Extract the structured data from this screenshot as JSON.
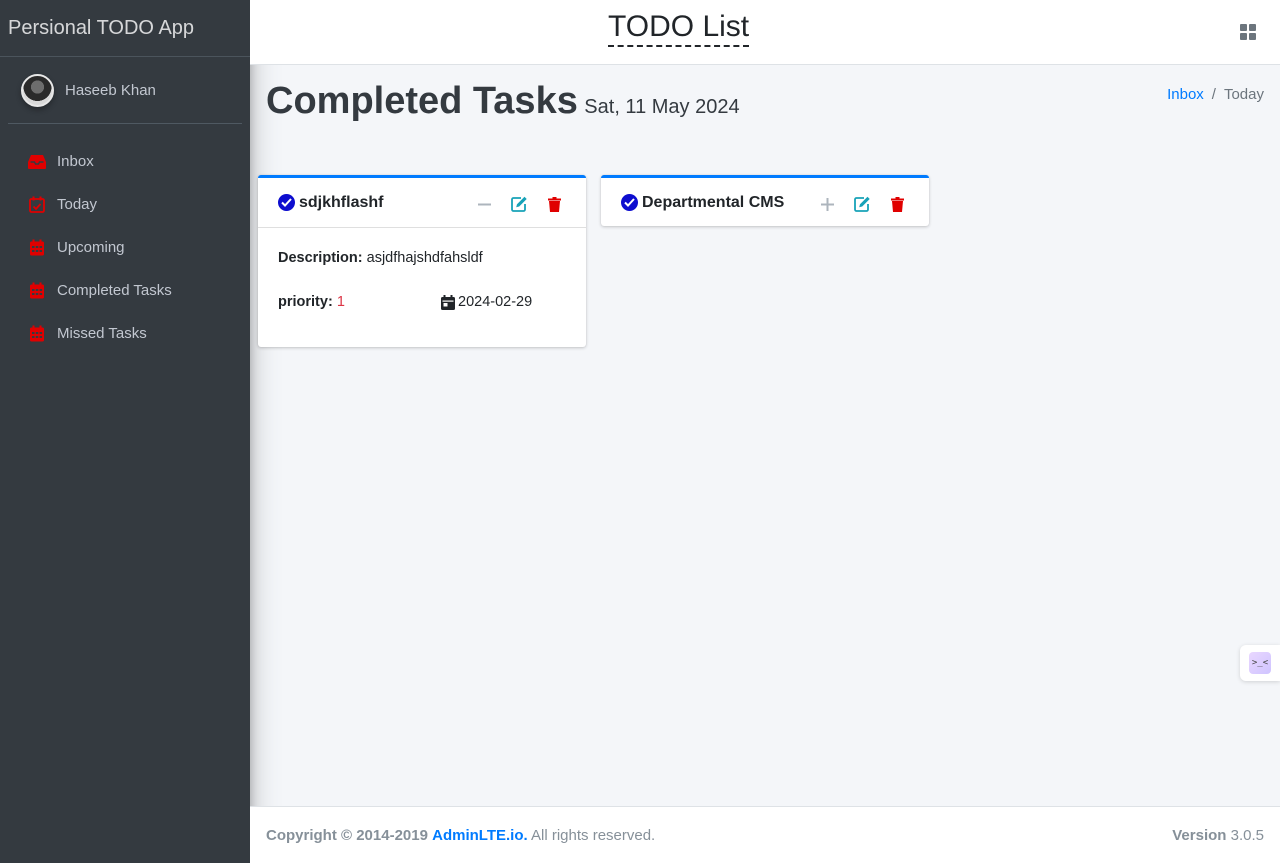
{
  "sidebar": {
    "brand": "Persional TODO App",
    "user": {
      "name": "Haseeb Khan"
    },
    "items": [
      {
        "label": "Inbox",
        "icon": "inbox-icon"
      },
      {
        "label": "Today",
        "icon": "calendar-check-icon"
      },
      {
        "label": "Upcoming",
        "icon": "calendar-icon"
      },
      {
        "label": "Completed Tasks",
        "icon": "calendar-icon"
      },
      {
        "label": "Missed Tasks",
        "icon": "calendar-icon"
      }
    ],
    "icon_color": "#e00000"
  },
  "navbar": {
    "title": "TODO List",
    "apps_icon": "grid-icon"
  },
  "content_header": {
    "title": "Completed Tasks",
    "date": "Sat, 11 May 2024",
    "breadcrumb": {
      "link": "Inbox",
      "separator": "/",
      "active": "Today"
    }
  },
  "tasks": [
    {
      "title": "sdjkhflashf",
      "description_label": "Description:",
      "description": "asjdfhajshdfahsldf",
      "priority_label": "priority:",
      "priority": "1",
      "date": "2024-02-29",
      "collapse_symbol": "−",
      "expanded": true
    },
    {
      "title": "Departmental CMS",
      "collapse_symbol": "+",
      "expanded": false
    }
  ],
  "footer": {
    "copyright": "Copyright © 2014-2019",
    "brand_link": "AdminLTE.io.",
    "rights": "All rights reserved.",
    "version_label": "Version",
    "version": "3.0.5"
  },
  "widget": {
    "label": ">_<"
  },
  "colors": {
    "accent": "#007bff",
    "danger": "#e00000",
    "edit": "#17a2b8",
    "sidebar": "#343a40"
  }
}
